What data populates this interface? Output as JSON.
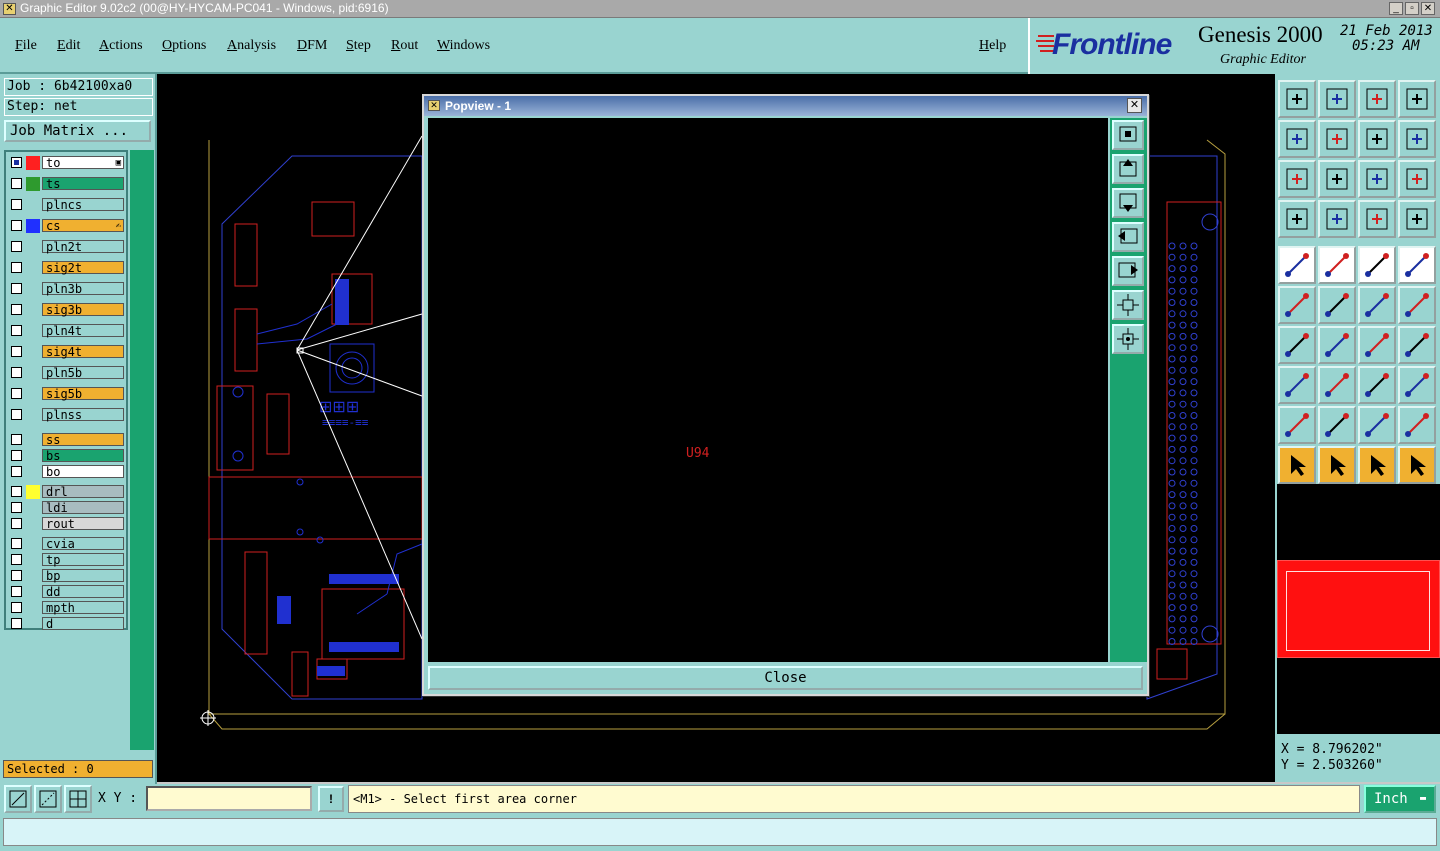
{
  "window": {
    "title": "Graphic Editor 9.02c2 (00@HY-HYCAM-PC041 - Windows, pid:6916)"
  },
  "menu": {
    "file": "File",
    "edit": "Edit",
    "actions": "Actions",
    "options": "Options",
    "analysis": "Analysis",
    "dfm": "DFM",
    "step": "Step",
    "rout": "Rout",
    "windows": "Windows",
    "help": "Help"
  },
  "brand": {
    "logo": "Frontline",
    "product": "Genesis 2000",
    "subtitle": "Graphic Editor",
    "date": "21 Feb 2013",
    "time": "05:23 AM"
  },
  "job": {
    "job_label": "Job : 6b42100xa0",
    "step_label": "Step: net",
    "matrix_button": "Job Matrix ..."
  },
  "layers": [
    {
      "name": "to",
      "bg": "#ffffff",
      "swatch": "#ff2020",
      "extra": "▣",
      "checked": true
    },
    {
      "name": "ts",
      "bg": "#1aa36f",
      "swatch": "#2e9a2e",
      "checked": false
    },
    {
      "name": "plncs",
      "bg": "#99d4d0",
      "swatch": "",
      "checked": false
    },
    {
      "name": "cs",
      "bg": "#f0b030",
      "swatch": "#2030ff",
      "extra": "✍",
      "checked": false
    },
    {
      "name": "pln2t",
      "bg": "#99d4d0",
      "swatch": "",
      "checked": false
    },
    {
      "name": "sig2t",
      "bg": "#f0b030",
      "swatch": "",
      "checked": false
    },
    {
      "name": "pln3b",
      "bg": "#99d4d0",
      "swatch": "",
      "checked": false
    },
    {
      "name": "sig3b",
      "bg": "#f0b030",
      "swatch": "",
      "checked": false
    },
    {
      "name": "pln4t",
      "bg": "#99d4d0",
      "swatch": "",
      "checked": false
    },
    {
      "name": "sig4t",
      "bg": "#f0b030",
      "swatch": "",
      "checked": false
    },
    {
      "name": "pln5b",
      "bg": "#99d4d0",
      "swatch": "",
      "checked": false
    },
    {
      "name": "sig5b",
      "bg": "#f0b030",
      "swatch": "",
      "checked": false
    },
    {
      "name": "plnss",
      "bg": "#99d4d0",
      "swatch": "",
      "checked": false
    },
    {
      "name": "ss",
      "bg": "#f0b030",
      "swatch": "",
      "checked": false
    },
    {
      "name": "bs",
      "bg": "#1aa36f",
      "swatch": "",
      "checked": false
    },
    {
      "name": "bo",
      "bg": "#ffffff",
      "swatch": "",
      "checked": false
    },
    {
      "name": "drl",
      "bg": "#a8bcc0",
      "swatch": "#ffff30",
      "checked": false
    },
    {
      "name": "ldi",
      "bg": "#a8bcc0",
      "swatch": "",
      "checked": false
    },
    {
      "name": "rout",
      "bg": "#d8d8d8",
      "swatch": "",
      "checked": false
    },
    {
      "name": "cvia",
      "bg": "#99d4d0",
      "swatch": "",
      "checked": false
    },
    {
      "name": "tp",
      "bg": "#99d4d0",
      "swatch": "",
      "checked": false
    },
    {
      "name": "bp",
      "bg": "#99d4d0",
      "swatch": "",
      "checked": false
    },
    {
      "name": "dd",
      "bg": "#99d4d0",
      "swatch": "",
      "checked": false
    },
    {
      "name": "mpth",
      "bg": "#99d4d0",
      "swatch": "",
      "checked": false
    },
    {
      "name": "d",
      "bg": "#99d4d0",
      "swatch": "",
      "checked": false
    }
  ],
  "selected": "Selected : 0",
  "popview": {
    "title": "Popview - 1",
    "component": "U94",
    "close_label": "Close",
    "close_x": "✕"
  },
  "coords": {
    "x": "X = 8.796202\"",
    "y": "Y = 2.503260\""
  },
  "bottom": {
    "xy_label": "X Y :",
    "xy_value": "",
    "prompt": "<M1> - Select first area corner",
    "units": "Inch"
  },
  "colors": {
    "panel": "#99d4d0",
    "accent_yellow": "#f0b030",
    "pcb_line": "#2030d0",
    "pcb_red": "#e02020"
  }
}
